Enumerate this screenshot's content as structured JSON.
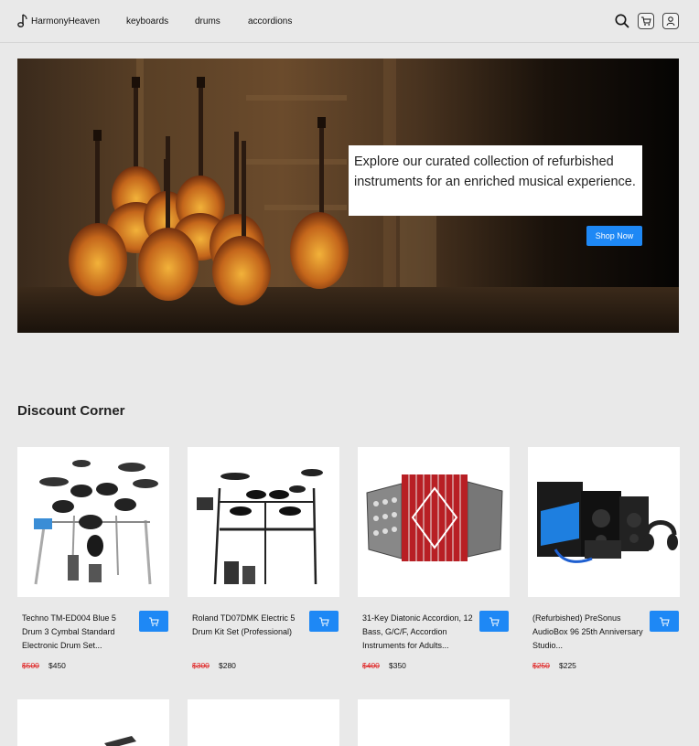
{
  "header": {
    "brand": "HarmonyHeaven",
    "nav": [
      "keyboards",
      "drums",
      "accordions"
    ]
  },
  "hero": {
    "text": "Explore our curated collection of refurbished instruments for an enriched musical experience.",
    "button_label": "Shop Now"
  },
  "section": {
    "title": "Discount Corner"
  },
  "products": [
    {
      "title": "Techno TM-ED004 Blue 5 Drum 3 Cymbal Standard Electronic Drum Set...",
      "old_price": "$500",
      "price": "$450"
    },
    {
      "title": "Roland TD07DMK Electric 5 Drum Kit Set (Professional)",
      "old_price": "$300",
      "price": "$280"
    },
    {
      "title": "31-Key Diatonic Accordion, 12 Bass, G/C/F, Accordion Instruments for Adults...",
      "old_price": "$400",
      "price": "$350"
    },
    {
      "title": "(Refurbished) PreSonus AudioBox 96 25th Anniversary Studio...",
      "old_price": "$250",
      "price": "$225"
    }
  ],
  "colors": {
    "accent": "#1e88f5",
    "background": "#e9e9e9",
    "sale_red": "#e02020"
  }
}
